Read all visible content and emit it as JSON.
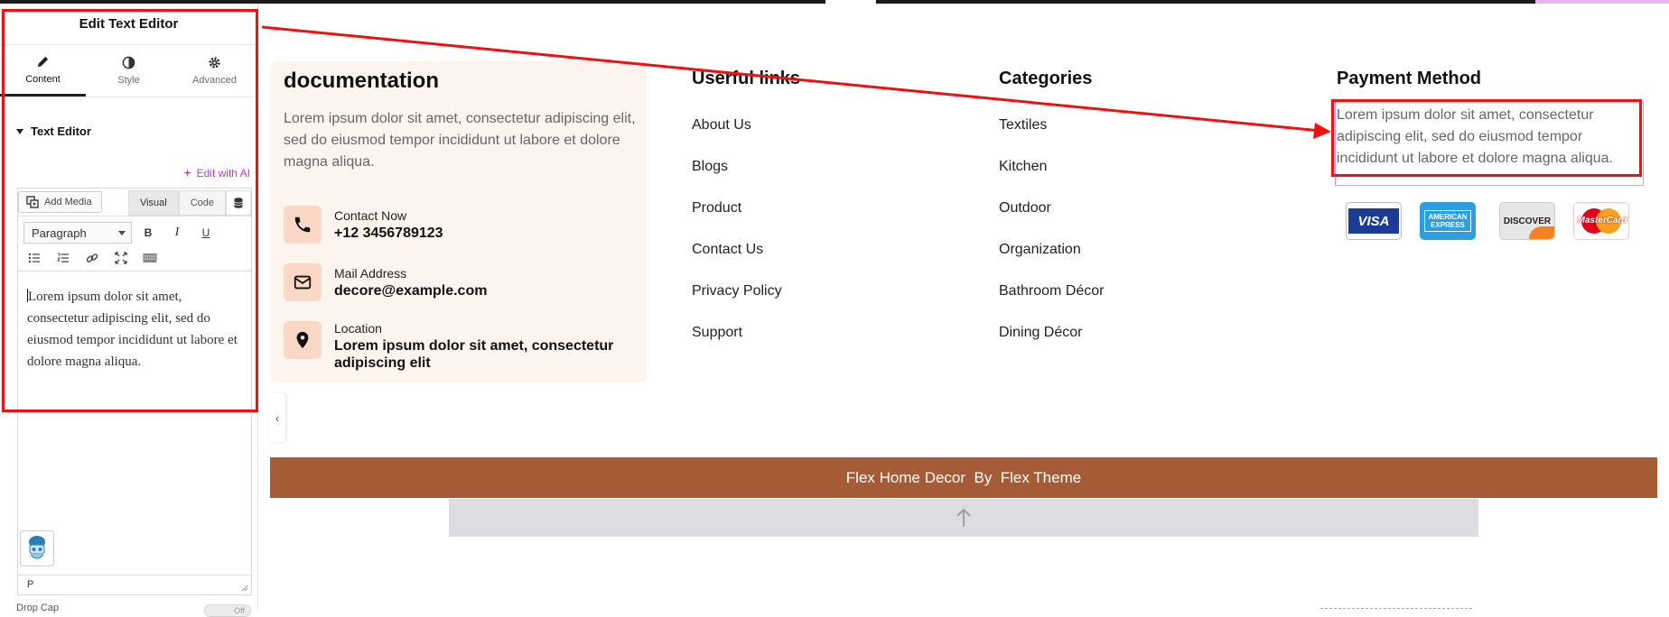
{
  "panel": {
    "title": "Edit Text Editor",
    "tabs": [
      {
        "label": "Content",
        "icon": "pencil-icon"
      },
      {
        "label": "Style",
        "icon": "half-circle-icon"
      },
      {
        "label": "Advanced",
        "icon": "gear-icon"
      }
    ],
    "section": "Text Editor",
    "ai_link": "Edit with AI",
    "editor": {
      "add_media": "Add Media",
      "tab_visual": "Visual",
      "tab_code": "Code",
      "format_select": "Paragraph",
      "bold": "B",
      "italic": "I",
      "underline": "U",
      "content": "Lorem ipsum dolor sit amet, consectetur adipiscing elit, sed do eiusmod tempor incididunt ut labore et dolore magna aliqua.",
      "path": "P"
    },
    "below_label": "Drop Cap",
    "toggle_label": "Off"
  },
  "footer": {
    "doc": {
      "title": "documentation",
      "description": "Lorem ipsum dolor sit amet, consectetur adipiscing elit, sed do eiusmod tempor incididunt ut labore et dolore magna aliqua.",
      "contacts": [
        {
          "label": "Contact Now",
          "value": "+12 3456789123",
          "icon": "phone-icon"
        },
        {
          "label": "Mail Address",
          "value": "decore@example.com",
          "icon": "mail-icon"
        },
        {
          "label": "Location",
          "value": "Lorem ipsum dolor sit amet, consectetur adipiscing elit",
          "icon": "location-pin-icon"
        }
      ]
    },
    "useful_links": {
      "title": "Userful links",
      "items": [
        "About Us",
        "Blogs",
        "Product",
        "Contact Us",
        "Privacy Policy",
        "Support"
      ]
    },
    "categories": {
      "title": "Categories",
      "items": [
        "Textiles",
        "Kitchen",
        "Outdoor",
        "Organization",
        "Bathroom Décor",
        "Dining Décor"
      ]
    },
    "payment": {
      "title": "Payment Method",
      "description": "Lorem ipsum dolor sit amet, consectetur adipiscing elit, sed do eiusmod tempor incididunt ut labore et dolore magna aliqua.",
      "cards": [
        "VISA",
        "AMERICAN EXPRESS",
        "DISCOVER",
        "MasterCard"
      ]
    },
    "copyright": "Flex Home Decor  By  Flex Theme"
  },
  "colors": {
    "accent_brown": "#a55c36",
    "card_bg": "#fdf4ee",
    "icon_bg": "#f9d8c6",
    "annotation_red": "#ee1111",
    "ai_purple": "#c036d6"
  }
}
